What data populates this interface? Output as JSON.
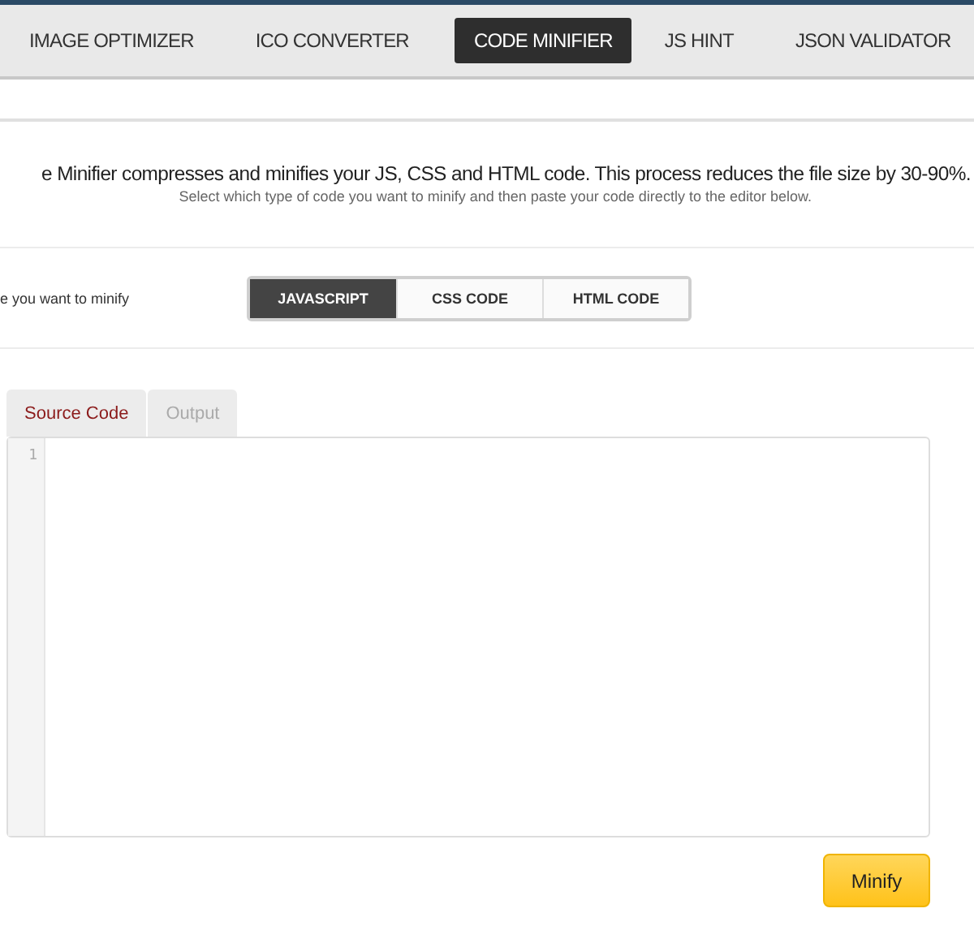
{
  "nav": [
    {
      "label": "IMAGE OPTIMIZER",
      "selected": false
    },
    {
      "label": "ICO CONVERTER",
      "selected": false
    },
    {
      "label": "CODE MINIFIER",
      "selected": true
    },
    {
      "label": "JS HINT",
      "selected": false
    },
    {
      "label": "JSON VALIDATOR",
      "selected": false
    }
  ],
  "intro": {
    "heading": "e Minifier compresses and minifies your JS, CSS and HTML code. This process reduces the file size by 30-90%.",
    "subtitle": "Select which type of code you want to minify and then paste your code directly to the editor below."
  },
  "type_picker": {
    "label": "e you want to minify",
    "options": [
      {
        "label": "JAVASCRIPT",
        "selected": true
      },
      {
        "label": "CSS CODE",
        "selected": false
      },
      {
        "label": "HTML CODE",
        "selected": false
      }
    ]
  },
  "editor_tabs": [
    {
      "label": "Source Code",
      "selected": true
    },
    {
      "label": "Output",
      "selected": false
    }
  ],
  "editor": {
    "line_numbers": [
      "1"
    ]
  },
  "minify_button": "Minify"
}
